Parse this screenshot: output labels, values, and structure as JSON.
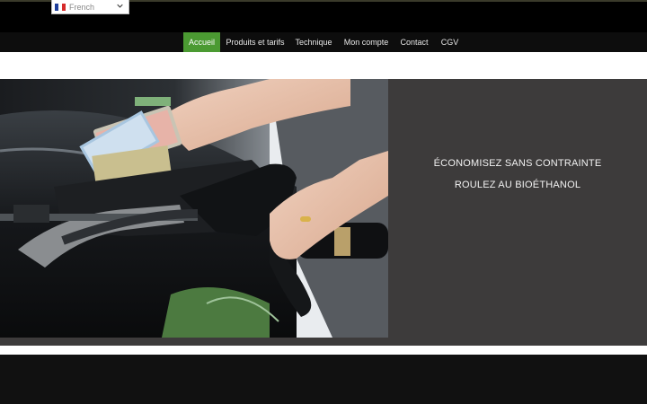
{
  "language_selector": {
    "value": "French",
    "flag_colors": [
      "#1f3f9c",
      "#ffffff",
      "#d62b2b"
    ],
    "icon": "chevron-down-icon"
  },
  "nav": {
    "items": [
      {
        "label": "Accueil",
        "active": true
      },
      {
        "label": "Produits et tarifs",
        "active": false
      },
      {
        "label": "Technique",
        "active": false
      },
      {
        "label": "Mon compte",
        "active": false
      },
      {
        "label": "Contact",
        "active": false
      },
      {
        "label": "CGV",
        "active": false
      }
    ],
    "active_color": "#4b9a32"
  },
  "hero": {
    "line1": "ÉCONOMISEZ SANS CONTRAINTE",
    "line2": "ROULEZ AU BIOÉTHANOL",
    "background": "#3d3b3b"
  }
}
